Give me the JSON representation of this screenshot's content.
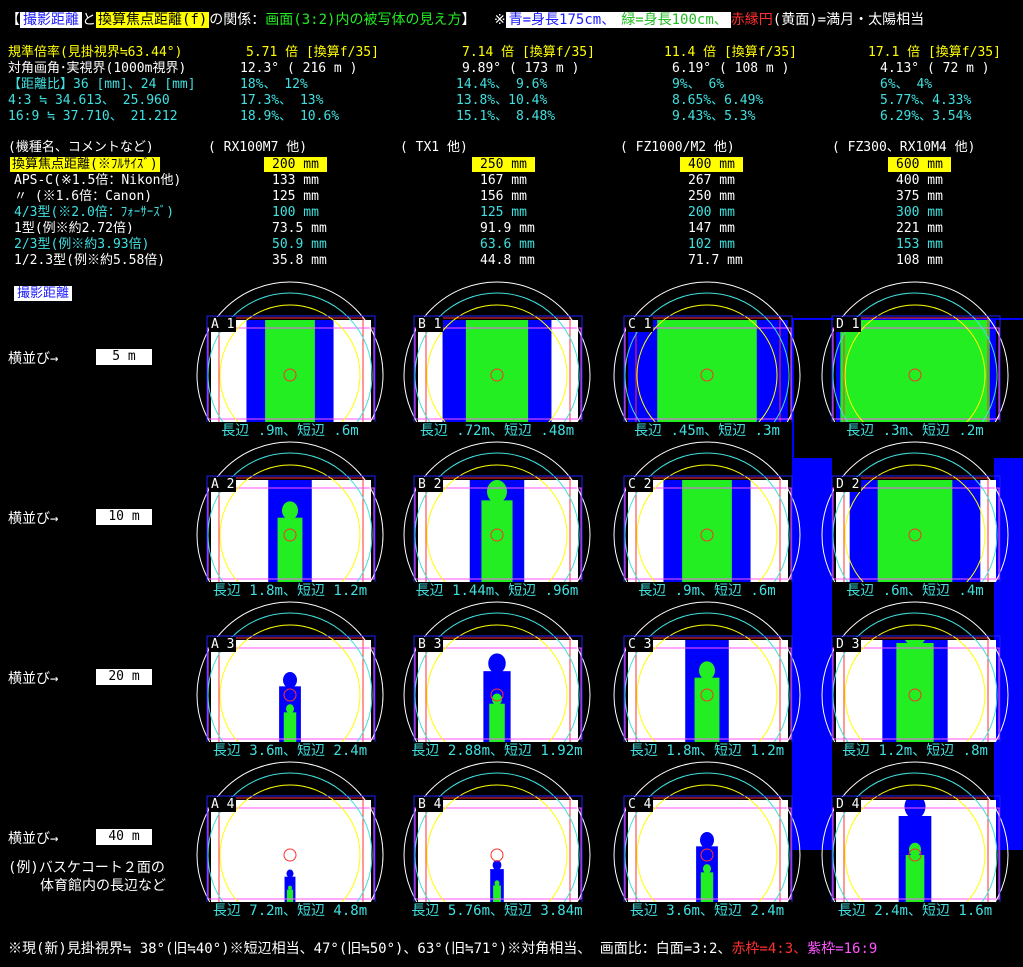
{
  "header": {
    "bracket_open": "【",
    "dist_label": "撮影距離",
    "and": "と",
    "focal_label": "換算焦点距離(f)",
    "relation": "の関係：",
    "screen_desc": "画面(3:2)内の被写体の見え方",
    "close": "】",
    "note_prefix": "※",
    "blue_note": "青=身長175cm、",
    "green_note": "緑=身長100cm、",
    "red_note": "赤縁円",
    "moon_note": "(黄面)=満月・太陽相当"
  },
  "spec": {
    "row1_label": "規準倍率(見掛視界≒63.44°)",
    "row2_label": "対角画角･実視界(1000m視界)",
    "row3_label": "【距離比】36 [mm]、24 [mm]",
    "row4_label": "  4:3 ≒ 34.613、 25.960",
    "row5_label": " 16:9 ≒ 37.710、 21.212",
    "cols": [
      {
        "mag": "5.71 倍 [換算f/35]",
        "angle": "12.3° ( 216 m )",
        "r36": "18%、    12%",
        "r43": "17.3%、  13%",
        "r169": "18.9%、  10.6%"
      },
      {
        "mag": "7.14 倍 [換算f/35]",
        "angle": "9.89° ( 173 m )",
        "r36": "14.4%、 9.6%",
        "r43": "13.8%、10.4%",
        "r169": "15.1%、 8.48%"
      },
      {
        "mag": "11.4 倍 [換算f/35]",
        "angle": "6.19° ( 108 m )",
        "r36": "9%、    6%",
        "r43": "8.65%、6.49%",
        "r169": "9.43%、5.3%"
      },
      {
        "mag": "17.1 倍 [換算f/35]",
        "angle": "4.13° ( 72 m )",
        "r36": "6%、    4%",
        "r43": "5.77%、4.33%",
        "r169": "6.29%、3.54%"
      }
    ]
  },
  "models": {
    "label": "(機種名、コメントなど)",
    "names": [
      "( RX100M7 他)",
      "( TX1 他)",
      "( FZ1000/M2 他)",
      "( FZ300、RX10M4 他)"
    ],
    "conv_label": "換算焦点距離(※ﾌﾙｻｲｽﾞ)",
    "conv_values": [
      "200 mm",
      "250 mm",
      "400 mm",
      "600 mm"
    ],
    "rows": [
      {
        "label": "APS-C(※1.5倍：Nikon他)",
        "cls": "w",
        "values": [
          "133 mm",
          "167 mm",
          "267 mm",
          "400 mm"
        ]
      },
      {
        "label": "  〃 (※1.6倍：Canon)",
        "cls": "w",
        "values": [
          "125 mm",
          "156 mm",
          "250 mm",
          "375 mm"
        ]
      },
      {
        "label": "4/3型(※2.0倍：ﾌｫｰｻｰｽﾞ)",
        "cls": "c",
        "values": [
          "100 mm",
          "125 mm",
          "200 mm",
          "300 mm"
        ]
      },
      {
        "label": " 1型(例※約2.72倍)",
        "cls": "w",
        "values": [
          "73.5 mm",
          "91.9 mm",
          "147 mm",
          "221 mm"
        ]
      },
      {
        "label": "2/3型(例※約3.93倍)",
        "cls": "c",
        "values": [
          "50.9 mm",
          "63.6 mm",
          "102 mm",
          "153 mm"
        ]
      },
      {
        "label": "1/2.3型(例※約5.58倍)",
        "cls": "w",
        "values": [
          "35.8 mm",
          "44.8 mm",
          "71.7 mm",
          "108 mm"
        ]
      }
    ]
  },
  "section_label": "撮影距離",
  "rows": [
    {
      "label": "横並び→",
      "dist": "5 m"
    },
    {
      "label": "横並び→",
      "dist": "10 m"
    },
    {
      "label": "横並び→",
      "dist": "20 m"
    },
    {
      "label": "横並び→",
      "dist": "40 m"
    }
  ],
  "note_bottom_1": "(例)バスケコート２面の",
  "note_bottom_2": "体育館内の長辺など",
  "cells": [
    [
      {
        "id": "A 1",
        "cap": "長辺 .9m、短辺 .6m"
      },
      {
        "id": "B 1",
        "cap": "長辺 .72m、短辺 .48m"
      },
      {
        "id": "C 1",
        "cap": "長辺 .45m、短辺 .3m"
      },
      {
        "id": "D 1",
        "cap": "長辺 .3m、短辺 .2m"
      }
    ],
    [
      {
        "id": "A 2",
        "cap": "長辺 1.8m、短辺 1.2m"
      },
      {
        "id": "B 2",
        "cap": "長辺 1.44m、短辺 .96m"
      },
      {
        "id": "C 2",
        "cap": "長辺 .9m、短辺 .6m"
      },
      {
        "id": "D 2",
        "cap": "長辺 .6m、短辺 .4m"
      }
    ],
    [
      {
        "id": "A 3",
        "cap": "長辺 3.6m、短辺 2.4m"
      },
      {
        "id": "B 3",
        "cap": "長辺 2.88m、短辺 1.92m"
      },
      {
        "id": "C 3",
        "cap": "長辺 1.8m、短辺 1.2m"
      },
      {
        "id": "D 3",
        "cap": "長辺 1.2m、短辺 .8m"
      }
    ],
    [
      {
        "id": "A 4",
        "cap": "長辺 7.2m、短辺 4.8m"
      },
      {
        "id": "B 4",
        "cap": "長辺 5.76m、短辺 3.84m"
      },
      {
        "id": "C 4",
        "cap": "長辺 3.6m、短辺 2.4m"
      },
      {
        "id": "D 4",
        "cap": "長辺 2.4m、短辺 1.6m"
      }
    ]
  ],
  "footer": {
    "main": "※現(新)見掛視界≒ 38°(旧≒40°)※短辺相当、47°(旧≒50°)、63°(旧≒71°)※対角相当、 画面比：白面=3:2、",
    "red": "赤枠=4:3、",
    "magenta": "紫枠=16:9"
  },
  "colors": {
    "blue": "#0000ff",
    "green": "#22ee22",
    "cyan": "#40e0e0",
    "yellow": "#ffff00",
    "red": "#ff3030",
    "magenta": "#ff55ff"
  }
}
